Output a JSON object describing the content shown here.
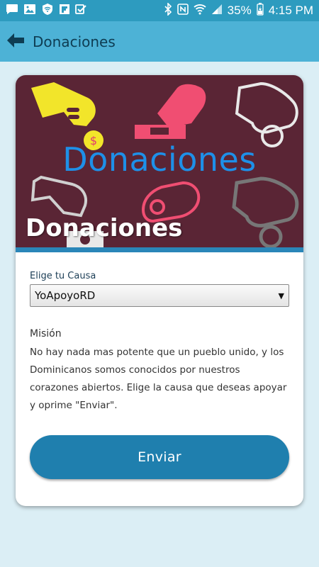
{
  "status_bar": {
    "battery": "35%",
    "time": "4:15 PM",
    "left_icons": [
      "message-icon",
      "image-icon",
      "wifi-shield-icon",
      "flipboard-icon",
      "check-app-icon"
    ],
    "right_icons": [
      "bluetooth-icon",
      "nfc-icon",
      "wifi-icon",
      "signal-icon",
      "battery-icon"
    ]
  },
  "app_bar": {
    "title": "Donaciones",
    "back_icon": "back-arrow-icon"
  },
  "banner": {
    "graphic_word": "Donaciones",
    "title": "Donaciones",
    "background": "#5a2535",
    "word_color": "#1e90e8"
  },
  "form": {
    "cause_label": "Elige tu Causa",
    "cause_selected": "YoApoyoRD"
  },
  "mission": {
    "title": "Misión",
    "text": "No hay nada mas potente que un pueblo unido, y los Dominicanos somos conocidos por nuestros corazones abiertos. Elige la causa que deseas apoyar y oprime \"Enviar\"."
  },
  "actions": {
    "send_label": "Enviar",
    "send_color": "#1f7fae"
  }
}
